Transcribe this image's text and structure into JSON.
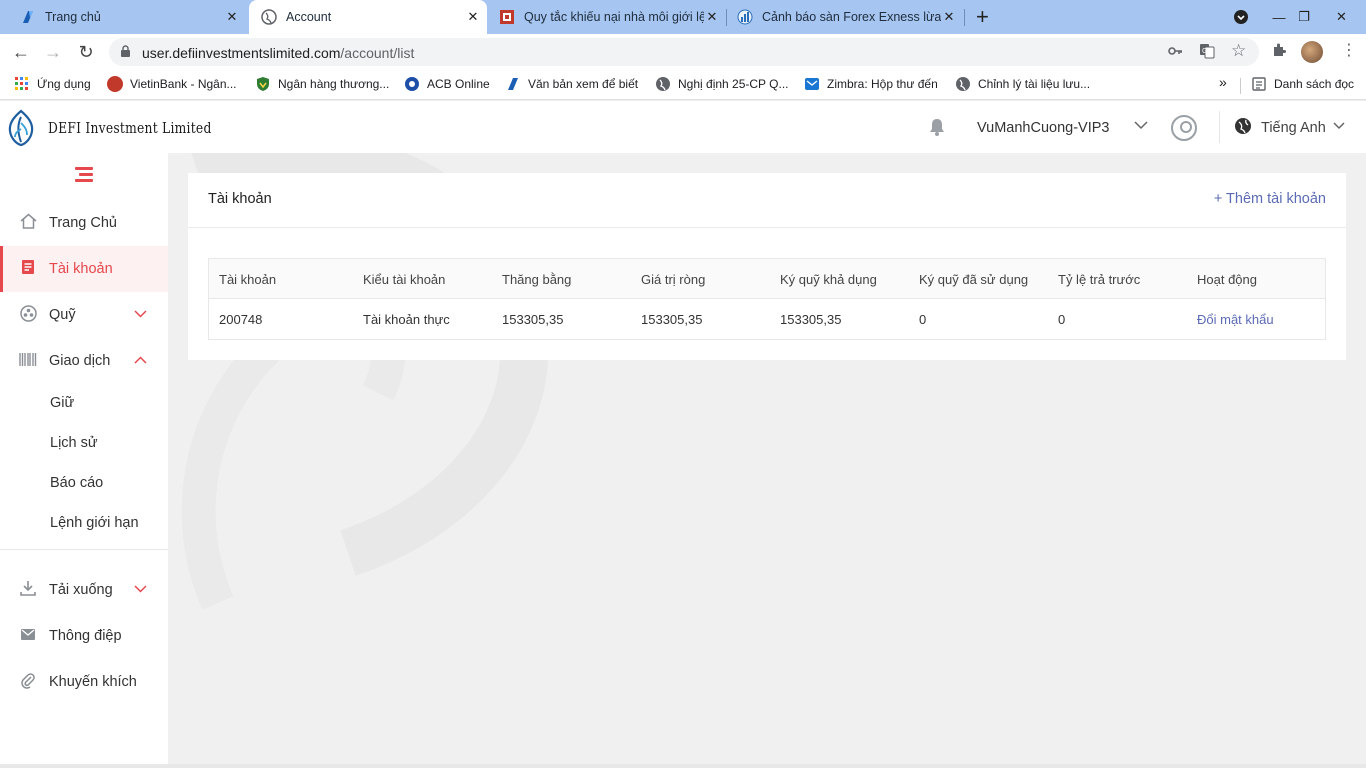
{
  "browser": {
    "tabs": [
      {
        "title": "Trang chủ",
        "icon": "vietinbank-favicon",
        "active": false
      },
      {
        "title": "Account",
        "icon": "globe-icon",
        "active": true
      },
      {
        "title": "Quy tắc khiếu nại nhà môi giới lệ",
        "icon": "red-square-favicon",
        "active": false
      },
      {
        "title": "Cảnh báo sàn Forex Exness lừa đ",
        "icon": "chart-favicon",
        "active": false
      }
    ],
    "url_host": "user.defiinvestmentslimited.com",
    "url_path": "/account/list",
    "bookmarks": [
      {
        "label": "Ứng dụng",
        "icon": "apps-grid-icon"
      },
      {
        "label": "VietinBank - Ngân...",
        "icon": "vietinbank-icon"
      },
      {
        "label": "Ngân hàng thương...",
        "icon": "shield-icon"
      },
      {
        "label": "ACB Online",
        "icon": "acb-icon"
      },
      {
        "label": "Văn bản xem để biết",
        "icon": "vietinbank-icon"
      },
      {
        "label": "Nghị định 25-CP Q...",
        "icon": "globe-icon"
      },
      {
        "label": "Zimbra: Hộp thư đến",
        "icon": "mail-icon"
      },
      {
        "label": "Chỉnh lý tài liệu lưu...",
        "icon": "globe-icon"
      }
    ],
    "more_bookmarks": "»",
    "reading_list": "Danh sách đọc"
  },
  "header": {
    "brand": "DEFI Investment Limited",
    "username": "VuManhCuong-VIP3",
    "language": "Tiếng Anh"
  },
  "sidebar": {
    "items": [
      {
        "label": "Trang Chủ",
        "icon": "home-icon"
      },
      {
        "label": "Tài khoản",
        "icon": "account-icon",
        "active": true
      },
      {
        "label": "Quỹ",
        "icon": "fund-icon",
        "chevron": "down"
      },
      {
        "label": "Giao dịch",
        "icon": "barcode-icon",
        "chevron": "up"
      }
    ],
    "subitems": [
      "Giữ",
      "Lịch sử",
      "Báo cáo",
      "Lệnh giới hạn"
    ],
    "bottom_items": [
      {
        "label": "Tải xuống",
        "icon": "download-icon",
        "chevron": "down"
      },
      {
        "label": "Thông điệp",
        "icon": "mail-icon"
      },
      {
        "label": "Khuyến khích",
        "icon": "paperclip-icon"
      }
    ]
  },
  "card": {
    "title": "Tài khoản",
    "add_button": "+ Thêm tài khoản",
    "columns": [
      "Tài khoản",
      "Kiểu tài khoản",
      "Thăng bằng",
      "Giá trị ròng",
      "Ký quỹ khả dụng",
      "Ký quỹ đã sử dụng",
      "Tỷ lệ trả trước",
      "Hoạt động"
    ],
    "rows": [
      [
        "200748",
        "Tài khoản thực",
        "153305,35",
        "153305,35",
        "153305,35",
        "0",
        "0",
        "Đổi mật khẩu"
      ]
    ]
  },
  "colors": {
    "accent": "#e5484d",
    "link": "#5b6bb5",
    "tabstrip": "#a6c5f1"
  }
}
